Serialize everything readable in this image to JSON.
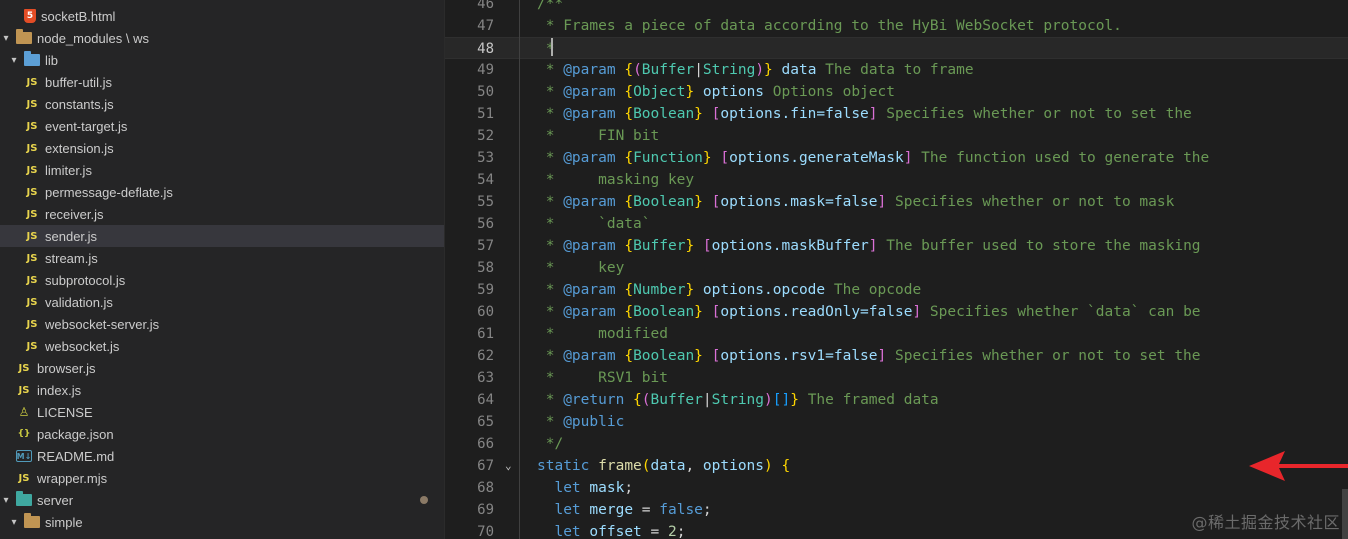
{
  "explorer": {
    "items": [
      {
        "label": "socketB.html",
        "icon": "html-icon",
        "kind": "file"
      },
      {
        "label": "node_modules \\ ws",
        "icon": "folder-icon",
        "kind": "folder-open"
      },
      {
        "label": "lib",
        "icon": "folder-lib-icon",
        "kind": "folder-open"
      },
      {
        "label": "buffer-util.js",
        "icon": "js-icon",
        "kind": "file"
      },
      {
        "label": "constants.js",
        "icon": "js-icon",
        "kind": "file"
      },
      {
        "label": "event-target.js",
        "icon": "js-icon",
        "kind": "file"
      },
      {
        "label": "extension.js",
        "icon": "js-icon",
        "kind": "file"
      },
      {
        "label": "limiter.js",
        "icon": "js-icon",
        "kind": "file"
      },
      {
        "label": "permessage-deflate.js",
        "icon": "js-icon",
        "kind": "file"
      },
      {
        "label": "receiver.js",
        "icon": "js-icon",
        "kind": "file"
      },
      {
        "label": "sender.js",
        "icon": "js-icon",
        "kind": "file",
        "selected": true
      },
      {
        "label": "stream.js",
        "icon": "js-icon",
        "kind": "file"
      },
      {
        "label": "subprotocol.js",
        "icon": "js-icon",
        "kind": "file"
      },
      {
        "label": "validation.js",
        "icon": "js-icon",
        "kind": "file"
      },
      {
        "label": "websocket-server.js",
        "icon": "js-icon",
        "kind": "file"
      },
      {
        "label": "websocket.js",
        "icon": "js-icon",
        "kind": "file"
      },
      {
        "label": "browser.js",
        "icon": "js-icon",
        "kind": "file"
      },
      {
        "label": "index.js",
        "icon": "js-icon",
        "kind": "file"
      },
      {
        "label": "LICENSE",
        "icon": "license-icon",
        "kind": "file"
      },
      {
        "label": "package.json",
        "icon": "json-icon",
        "kind": "file"
      },
      {
        "label": "README.md",
        "icon": "markdown-icon",
        "kind": "file"
      },
      {
        "label": "wrapper.mjs",
        "icon": "js-icon",
        "kind": "file"
      },
      {
        "label": "server",
        "icon": "folder-server-icon",
        "kind": "folder-open",
        "modified": true
      },
      {
        "label": "simple",
        "icon": "folder-icon",
        "kind": "folder-open"
      }
    ],
    "js_icon_text": "JS",
    "html_icon_text": "5",
    "json_icon_text": "{}",
    "md_icon_text": "M↓"
  },
  "editor": {
    "current_line": 48,
    "lines": [
      {
        "n": "46",
        "tokens": [
          [
            "c-com",
            "/**"
          ]
        ]
      },
      {
        "n": "47",
        "tokens": [
          [
            "c-com",
            " * Frames a piece of data according to the HyBi WebSocket protocol."
          ]
        ]
      },
      {
        "n": "48",
        "tokens": [
          [
            "c-com",
            " *"
          ]
        ]
      },
      {
        "n": "49",
        "tokens": [
          [
            "c-com",
            " * "
          ],
          [
            "c-kw",
            "@param"
          ],
          [
            "c-com",
            " "
          ],
          [
            "c-br1",
            "{"
          ],
          [
            "c-br2",
            "("
          ],
          [
            "c-type",
            "Buffer"
          ],
          [
            "c-def",
            "|"
          ],
          [
            "c-type",
            "String"
          ],
          [
            "c-br2",
            ")"
          ],
          [
            "c-br1",
            "}"
          ],
          [
            "c-com",
            " "
          ],
          [
            "c-var",
            "data"
          ],
          [
            "c-com",
            " The data to frame"
          ]
        ]
      },
      {
        "n": "50",
        "tokens": [
          [
            "c-com",
            " * "
          ],
          [
            "c-kw",
            "@param"
          ],
          [
            "c-com",
            " "
          ],
          [
            "c-br1",
            "{"
          ],
          [
            "c-type",
            "Object"
          ],
          [
            "c-br1",
            "}"
          ],
          [
            "c-com",
            " "
          ],
          [
            "c-var",
            "options"
          ],
          [
            "c-com",
            " Options object"
          ]
        ]
      },
      {
        "n": "51",
        "tokens": [
          [
            "c-com",
            " * "
          ],
          [
            "c-kw",
            "@param"
          ],
          [
            "c-com",
            " "
          ],
          [
            "c-br1",
            "{"
          ],
          [
            "c-type",
            "Boolean"
          ],
          [
            "c-br1",
            "}"
          ],
          [
            "c-com",
            " "
          ],
          [
            "c-br2",
            "["
          ],
          [
            "c-var",
            "options.fin=false"
          ],
          [
            "c-br2",
            "]"
          ],
          [
            "c-com",
            " Specifies whether or not to set the"
          ]
        ]
      },
      {
        "n": "52",
        "tokens": [
          [
            "c-com",
            " *     FIN bit"
          ]
        ]
      },
      {
        "n": "53",
        "tokens": [
          [
            "c-com",
            " * "
          ],
          [
            "c-kw",
            "@param"
          ],
          [
            "c-com",
            " "
          ],
          [
            "c-br1",
            "{"
          ],
          [
            "c-type",
            "Function"
          ],
          [
            "c-br1",
            "}"
          ],
          [
            "c-com",
            " "
          ],
          [
            "c-br2",
            "["
          ],
          [
            "c-var",
            "options.generateMask"
          ],
          [
            "c-br2",
            "]"
          ],
          [
            "c-com",
            " The function used to generate the"
          ]
        ]
      },
      {
        "n": "54",
        "tokens": [
          [
            "c-com",
            " *     masking key"
          ]
        ]
      },
      {
        "n": "55",
        "tokens": [
          [
            "c-com",
            " * "
          ],
          [
            "c-kw",
            "@param"
          ],
          [
            "c-com",
            " "
          ],
          [
            "c-br1",
            "{"
          ],
          [
            "c-type",
            "Boolean"
          ],
          [
            "c-br1",
            "}"
          ],
          [
            "c-com",
            " "
          ],
          [
            "c-br2",
            "["
          ],
          [
            "c-var",
            "options.mask=false"
          ],
          [
            "c-br2",
            "]"
          ],
          [
            "c-com",
            " Specifies whether or not to mask"
          ]
        ]
      },
      {
        "n": "56",
        "tokens": [
          [
            "c-com",
            " *     `data`"
          ]
        ]
      },
      {
        "n": "57",
        "tokens": [
          [
            "c-com",
            " * "
          ],
          [
            "c-kw",
            "@param"
          ],
          [
            "c-com",
            " "
          ],
          [
            "c-br1",
            "{"
          ],
          [
            "c-type",
            "Buffer"
          ],
          [
            "c-br1",
            "}"
          ],
          [
            "c-com",
            " "
          ],
          [
            "c-br2",
            "["
          ],
          [
            "c-var",
            "options.maskBuffer"
          ],
          [
            "c-br2",
            "]"
          ],
          [
            "c-com",
            " The buffer used to store the masking"
          ]
        ]
      },
      {
        "n": "58",
        "tokens": [
          [
            "c-com",
            " *     key"
          ]
        ]
      },
      {
        "n": "59",
        "tokens": [
          [
            "c-com",
            " * "
          ],
          [
            "c-kw",
            "@param"
          ],
          [
            "c-com",
            " "
          ],
          [
            "c-br1",
            "{"
          ],
          [
            "c-type",
            "Number"
          ],
          [
            "c-br1",
            "}"
          ],
          [
            "c-com",
            " "
          ],
          [
            "c-var",
            "options.opcode"
          ],
          [
            "c-com",
            " The opcode"
          ]
        ]
      },
      {
        "n": "60",
        "tokens": [
          [
            "c-com",
            " * "
          ],
          [
            "c-kw",
            "@param"
          ],
          [
            "c-com",
            " "
          ],
          [
            "c-br1",
            "{"
          ],
          [
            "c-type",
            "Boolean"
          ],
          [
            "c-br1",
            "}"
          ],
          [
            "c-com",
            " "
          ],
          [
            "c-br2",
            "["
          ],
          [
            "c-var",
            "options.readOnly=false"
          ],
          [
            "c-br2",
            "]"
          ],
          [
            "c-com",
            " Specifies whether `data` can be"
          ]
        ]
      },
      {
        "n": "61",
        "tokens": [
          [
            "c-com",
            " *     modified"
          ]
        ]
      },
      {
        "n": "62",
        "tokens": [
          [
            "c-com",
            " * "
          ],
          [
            "c-kw",
            "@param"
          ],
          [
            "c-com",
            " "
          ],
          [
            "c-br1",
            "{"
          ],
          [
            "c-type",
            "Boolean"
          ],
          [
            "c-br1",
            "}"
          ],
          [
            "c-com",
            " "
          ],
          [
            "c-br2",
            "["
          ],
          [
            "c-var",
            "options.rsv1=false"
          ],
          [
            "c-br2",
            "]"
          ],
          [
            "c-com",
            " Specifies whether or not to set the"
          ]
        ]
      },
      {
        "n": "63",
        "tokens": [
          [
            "c-com",
            " *     RSV1 bit"
          ]
        ]
      },
      {
        "n": "64",
        "tokens": [
          [
            "c-com",
            " * "
          ],
          [
            "c-kw",
            "@return"
          ],
          [
            "c-com",
            " "
          ],
          [
            "c-br1",
            "{"
          ],
          [
            "c-br2",
            "("
          ],
          [
            "c-type",
            "Buffer"
          ],
          [
            "c-def",
            "|"
          ],
          [
            "c-type",
            "String"
          ],
          [
            "c-br2",
            ")"
          ],
          [
            "c-br3",
            "[]"
          ],
          [
            "c-br1",
            "}"
          ],
          [
            "c-com",
            " The framed data"
          ]
        ]
      },
      {
        "n": "65",
        "tokens": [
          [
            "c-com",
            " * "
          ],
          [
            "c-kw",
            "@public"
          ]
        ]
      },
      {
        "n": "66",
        "tokens": [
          [
            "c-com",
            " */"
          ]
        ]
      },
      {
        "n": "67",
        "tokens": [
          [
            "c-kw",
            "static"
          ],
          [
            "c-def",
            " "
          ],
          [
            "c-fn",
            "frame"
          ],
          [
            "c-br1",
            "("
          ],
          [
            "c-var",
            "data"
          ],
          [
            "c-def",
            ", "
          ],
          [
            "c-var",
            "options"
          ],
          [
            "c-br1",
            ")"
          ],
          [
            "c-def",
            " "
          ],
          [
            "c-br1",
            "{"
          ]
        ],
        "fold": true
      },
      {
        "n": "68",
        "tokens": [
          [
            "c-def",
            "  "
          ],
          [
            "c-kw",
            "let"
          ],
          [
            "c-def",
            " "
          ],
          [
            "c-var",
            "mask"
          ],
          [
            "c-def",
            ";"
          ]
        ]
      },
      {
        "n": "69",
        "tokens": [
          [
            "c-def",
            "  "
          ],
          [
            "c-kw",
            "let"
          ],
          [
            "c-def",
            " "
          ],
          [
            "c-var",
            "merge"
          ],
          [
            "c-def",
            " = "
          ],
          [
            "c-kw",
            "false"
          ],
          [
            "c-def",
            ";"
          ]
        ]
      },
      {
        "n": "70",
        "tokens": [
          [
            "c-def",
            "  "
          ],
          [
            "c-kw",
            "let"
          ],
          [
            "c-def",
            " "
          ],
          [
            "c-var",
            "offset"
          ],
          [
            "c-def",
            " = "
          ],
          [
            "c-num",
            "2"
          ],
          [
            "c-def",
            ";"
          ]
        ]
      }
    ]
  },
  "annotation": {
    "arrow_color": "#e8262b",
    "target_line": "67"
  },
  "watermark": "@稀土掘金技术社区"
}
